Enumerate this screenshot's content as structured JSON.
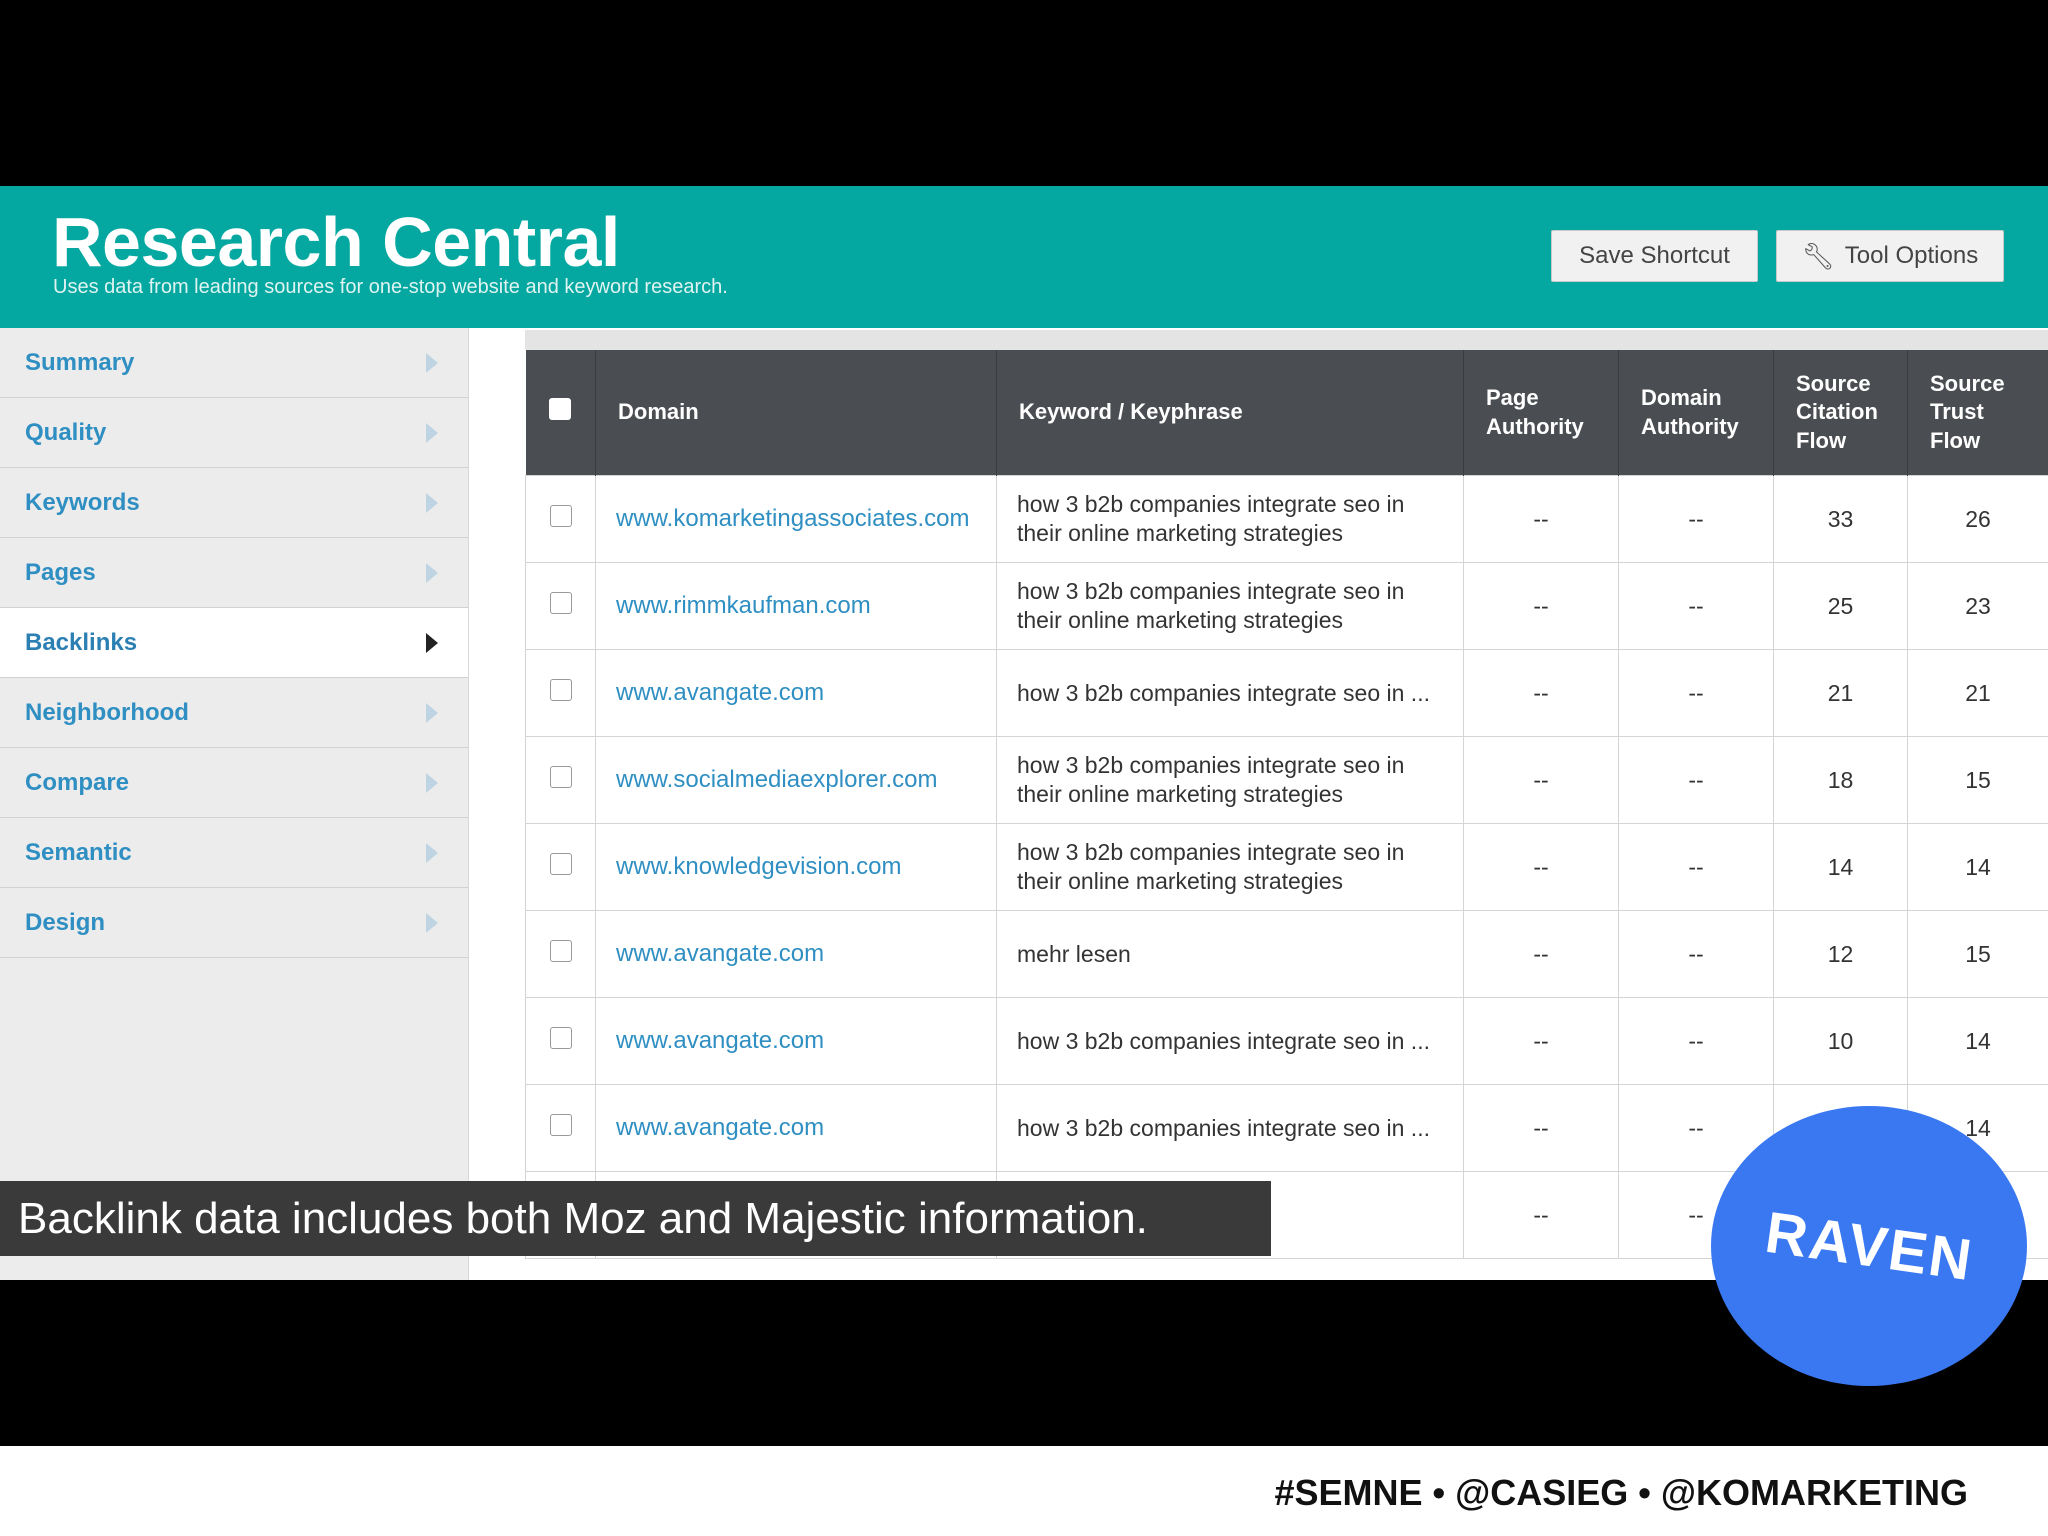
{
  "header": {
    "title": "Research Central",
    "subtitle": "Uses data from leading sources for one-stop website and keyword research.",
    "save_label": "Save Shortcut",
    "tool_label": "Tool Options"
  },
  "sidebar": {
    "items": [
      {
        "label": "Summary"
      },
      {
        "label": "Quality"
      },
      {
        "label": "Keywords"
      },
      {
        "label": "Pages"
      },
      {
        "label": "Backlinks",
        "active": true
      },
      {
        "label": "Neighborhood"
      },
      {
        "label": "Compare"
      },
      {
        "label": "Semantic"
      },
      {
        "label": "Design"
      }
    ]
  },
  "table": {
    "headers": {
      "domain": "Domain",
      "keyword": "Keyword / Keyphrase",
      "page_authority": "Page Authority",
      "domain_authority": "Domain Authority",
      "citation_flow": "Source Citation Flow",
      "trust_flow": "Source Trust Flow"
    },
    "rows": [
      {
        "domain": "www.komarketingassociates.com",
        "keyword": "how 3 b2b companies integrate seo in their online marketing strategies",
        "pa": "--",
        "da": "--",
        "cf": "33",
        "tf": "26"
      },
      {
        "domain": "www.rimmkaufman.com",
        "keyword": "how 3 b2b companies integrate seo in their online marketing strategies",
        "pa": "--",
        "da": "--",
        "cf": "25",
        "tf": "23"
      },
      {
        "domain": "www.avangate.com",
        "keyword": "how 3 b2b companies integrate seo in ...",
        "pa": "--",
        "da": "--",
        "cf": "21",
        "tf": "21"
      },
      {
        "domain": "www.socialmediaexplorer.com",
        "keyword": "how 3 b2b companies integrate seo in their online marketing strategies",
        "pa": "--",
        "da": "--",
        "cf": "18",
        "tf": "15"
      },
      {
        "domain": "www.knowledgevision.com",
        "keyword": "how 3 b2b companies integrate seo in their online marketing strategies",
        "pa": "--",
        "da": "--",
        "cf": "14",
        "tf": "14"
      },
      {
        "domain": "www.avangate.com",
        "keyword": "mehr lesen",
        "pa": "--",
        "da": "--",
        "cf": "12",
        "tf": "15"
      },
      {
        "domain": "www.avangate.com",
        "keyword": "how 3 b2b companies integrate seo in ...",
        "pa": "--",
        "da": "--",
        "cf": "10",
        "tf": "14"
      },
      {
        "domain": "www.avangate.com",
        "keyword": "how 3 b2b companies integrate seo in ...",
        "pa": "--",
        "da": "--",
        "cf": "",
        "tf": "14"
      },
      {
        "domain": "",
        "keyword": "",
        "pa": "--",
        "da": "--",
        "cf": "",
        "tf": ""
      }
    ]
  },
  "caption": "Backlink data includes both Moz and Majestic information.",
  "badge": "RAVEN",
  "footer": "#SEMNE • @CASIEG • @KOMARKETING",
  "colors": {
    "header_bg": "#05a8a0",
    "link": "#2f8fc2",
    "table_header_bg": "#4a4d51",
    "badge_bg": "#3a78f2"
  }
}
